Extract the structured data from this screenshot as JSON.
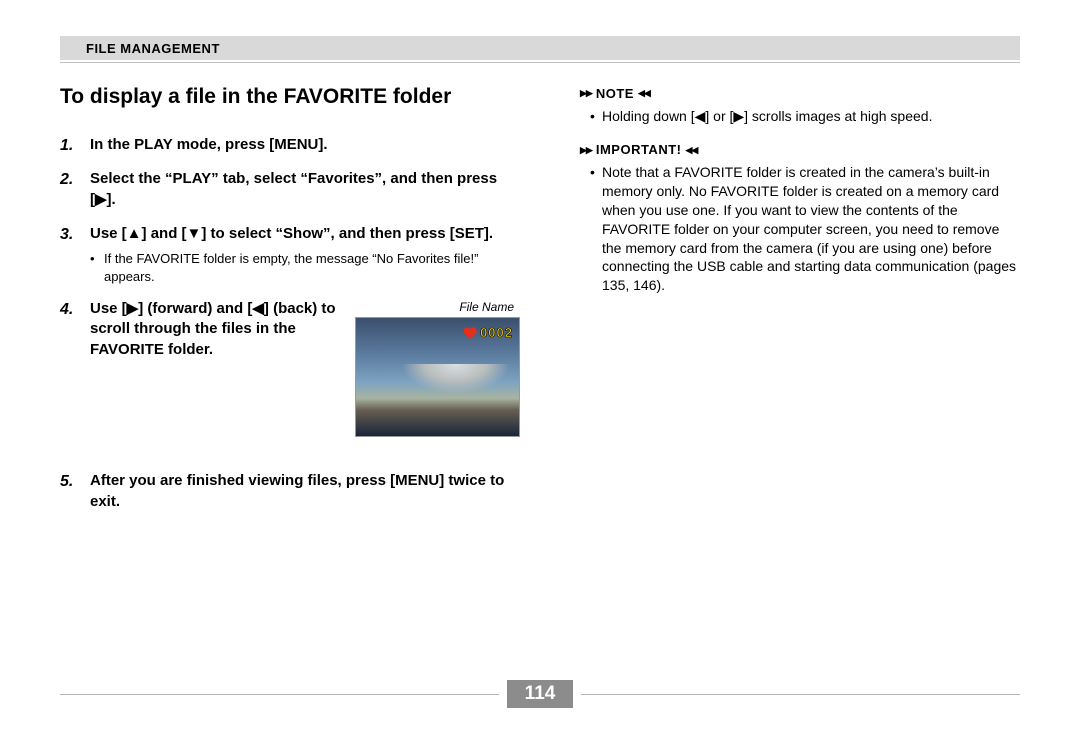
{
  "section_header": "File Management",
  "heading": "To display a file in the FAVORITE folder",
  "steps": {
    "s1": "In the PLAY mode, press [MENU].",
    "s2": "Select the “PLAY” tab, select “Favorites”, and then press [▶].",
    "s3": "Use [▲] and [▼] to select “Show”, and then press [SET].",
    "s3_sub": "If the FAVORITE folder is empty, the message “No Favorites file!” appears.",
    "s4": "Use [▶] (forward) and [◀] (back) to scroll through the files in the FAVORITE folder.",
    "s5": "After you are finished viewing files, press [MENU] twice to exit."
  },
  "thumb": {
    "file_name_label": "File Name",
    "badge_number": "0002"
  },
  "note": {
    "label": "NOTE",
    "item": "Holding down [◀] or [▶] scrolls images at high speed."
  },
  "important": {
    "label": "IMPORTANT!",
    "item": "Note that a FAVORITE folder is created in the camera’s built-in memory only. No FAVORITE folder is created on a memory card when you use one. If you want to view the contents of the FAVORITE folder on your computer screen, you need to remove the memory card from the camera (if you are using one) before connecting the USB cable and starting data communication (pages 135, 146)."
  },
  "page_number": "114"
}
